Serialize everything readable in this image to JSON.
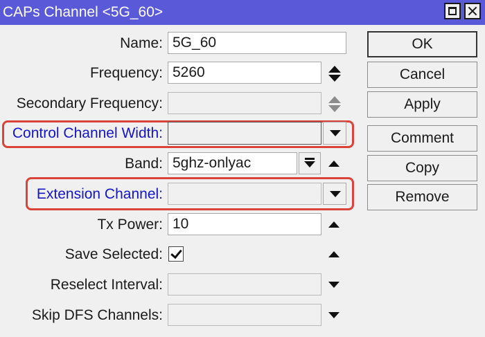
{
  "window": {
    "title": "CAPs Channel <5G_60>"
  },
  "form": {
    "name_label": "Name:",
    "name_value": "5G_60",
    "frequency_label": "Frequency:",
    "frequency_value": "5260",
    "secondary_frequency_label": "Secondary Frequency:",
    "secondary_frequency_value": "",
    "control_channel_width_label": "Control Channel Width:",
    "control_channel_width_value": "",
    "band_label": "Band:",
    "band_value": "5ghz-onlyac",
    "extension_channel_label": "Extension Channel:",
    "extension_channel_value": "",
    "tx_power_label": "Tx Power:",
    "tx_power_value": "10",
    "save_selected_label": "Save Selected:",
    "save_selected_checked": true,
    "reselect_interval_label": "Reselect Interval:",
    "reselect_interval_value": "",
    "skip_dfs_label": "Skip DFS Channels:",
    "skip_dfs_value": ""
  },
  "buttons": {
    "ok": "OK",
    "cancel": "Cancel",
    "apply": "Apply",
    "comment": "Comment",
    "copy": "Copy",
    "remove": "Remove"
  },
  "colors": {
    "titlebar": "#5a59d8",
    "highlight": "#d9433a",
    "label_blue": "#1414c8"
  }
}
